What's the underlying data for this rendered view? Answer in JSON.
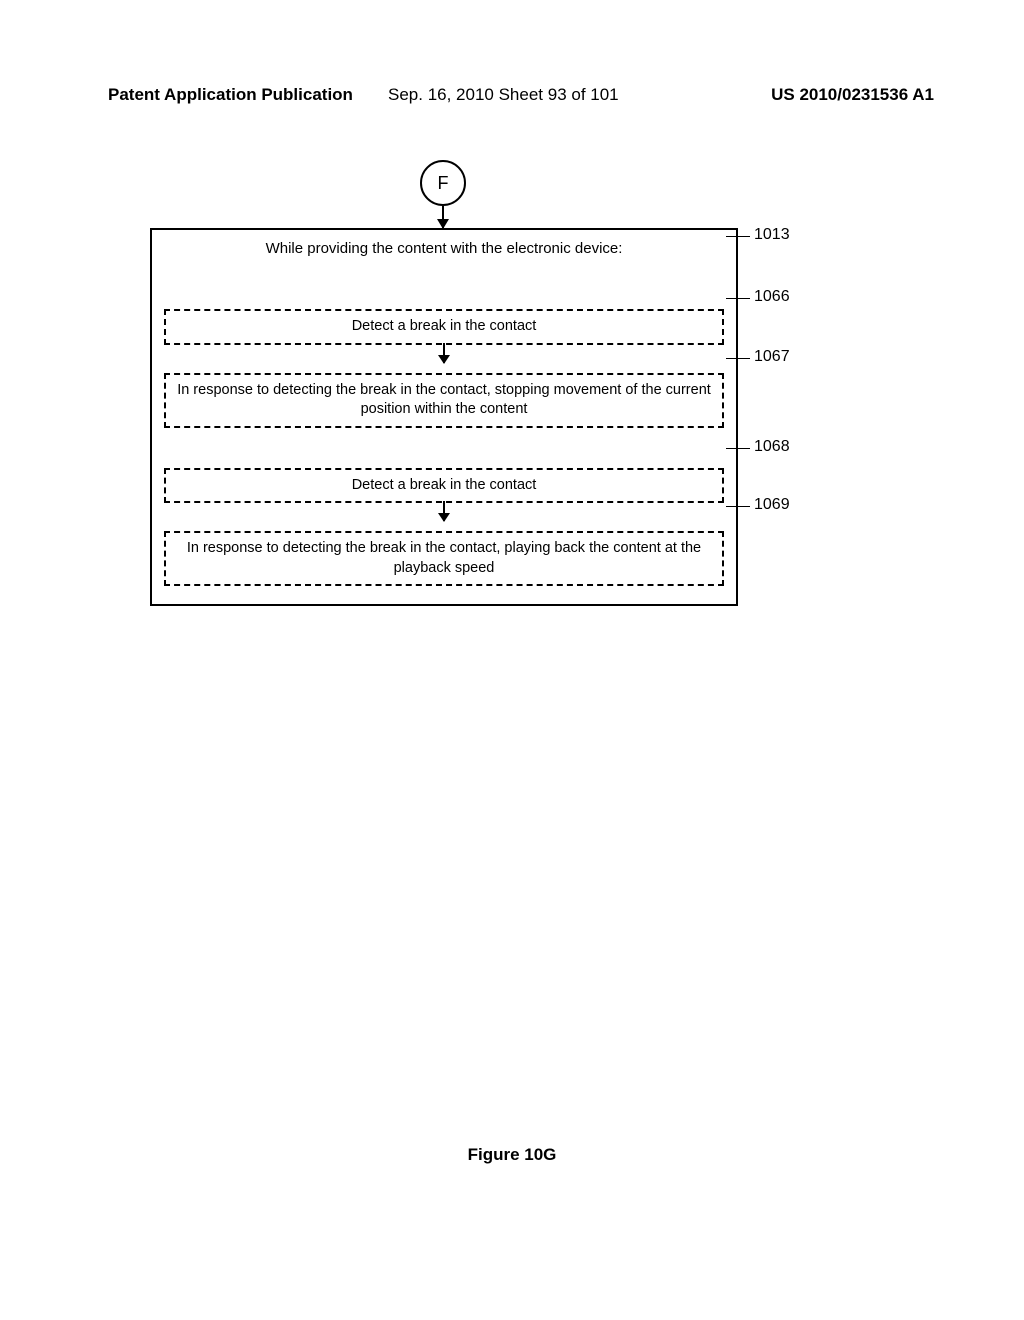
{
  "header": {
    "left": "Patent Application Publication",
    "mid": "Sep. 16, 2010  Sheet 93 of 101",
    "right": "US 2010/0231536 A1"
  },
  "flow": {
    "connector": "F",
    "outer_title": "While providing the content with the electronic device:",
    "steps": [
      {
        "text": "Detect a break in the contact",
        "ref": "1066"
      },
      {
        "text": "In response to detecting the break in the contact, stopping movement of the current position within the content",
        "ref": "1067"
      },
      {
        "text": "Detect a break in the contact",
        "ref": "1068"
      },
      {
        "text": "In response to detecting the break in the contact, playing back the content at the playback speed",
        "ref": "1069"
      }
    ],
    "outer_ref": "1013"
  },
  "figure_label": "Figure 10G"
}
